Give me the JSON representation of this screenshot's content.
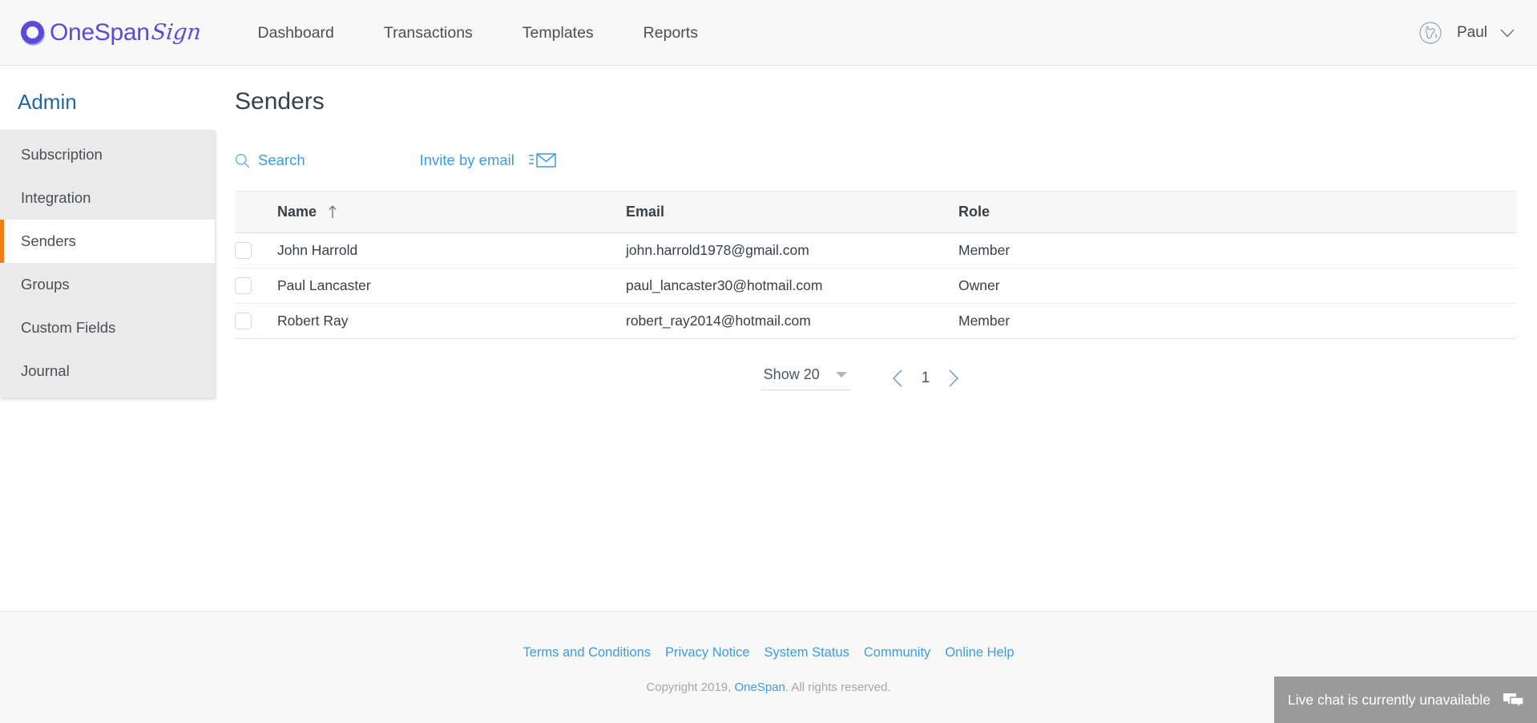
{
  "brand": {
    "logo_primary": "OneSpan",
    "logo_script": "Sign",
    "logo_icon": "onespan-ring-logo",
    "accent_purple": "#5b4bd6",
    "accent_blue": "#3e9bdd",
    "accent_orange": "#f07c12",
    "heading_blue": "#1f6a9e"
  },
  "topnav": {
    "items": [
      {
        "label": "Dashboard",
        "name": "nav-dashboard"
      },
      {
        "label": "Transactions",
        "name": "nav-transactions"
      },
      {
        "label": "Templates",
        "name": "nav-templates"
      },
      {
        "label": "Reports",
        "name": "nav-reports"
      }
    ],
    "globe_icon": "globe-icon",
    "user": "Paul",
    "chevron_icon": "chevron-down-icon"
  },
  "sidebar": {
    "title": "Admin",
    "items": [
      {
        "label": "Subscription",
        "active": false
      },
      {
        "label": "Integration",
        "active": false
      },
      {
        "label": "Senders",
        "active": true
      },
      {
        "label": "Groups",
        "active": false
      },
      {
        "label": "Custom Fields",
        "active": false
      },
      {
        "label": "Journal",
        "active": false
      }
    ]
  },
  "main": {
    "page_title": "Senders",
    "toolbar": {
      "search_label": "Search",
      "search_icon": "search-icon",
      "invite_label": "Invite by email",
      "invite_icon": "envelope-send-icon"
    },
    "table": {
      "columns": [
        "Name",
        "Email",
        "Role"
      ],
      "sort_column": "Name",
      "sort_direction": "ascending",
      "sort_icon": "arrow-up-icon",
      "rows": [
        {
          "checked": false,
          "name": "John Harrold",
          "email": "john.harrold1978@gmail.com",
          "role": "Member"
        },
        {
          "checked": false,
          "name": "Paul Lancaster",
          "email": "paul_lancaster30@hotmail.com",
          "role": "Owner"
        },
        {
          "checked": false,
          "name": "Robert Ray",
          "email": "robert_ray2014@hotmail.com",
          "role": "Member"
        }
      ]
    },
    "pagination": {
      "show_label": "Show 20",
      "caret_icon": "caret-down-icon",
      "prev_icon": "chevron-left-icon",
      "next_icon": "chevron-right-icon",
      "current_page": "1"
    }
  },
  "footer": {
    "links": [
      "Terms and Conditions",
      "Privacy Notice",
      "System Status",
      "Community",
      "Online Help"
    ],
    "copyright_prefix": "Copyright 2019, ",
    "copyright_link": "OneSpan",
    "copyright_suffix": ". All rights reserved."
  },
  "chat": {
    "message": "Live chat is currently unavailable",
    "icon": "chat-bubbles-icon"
  }
}
